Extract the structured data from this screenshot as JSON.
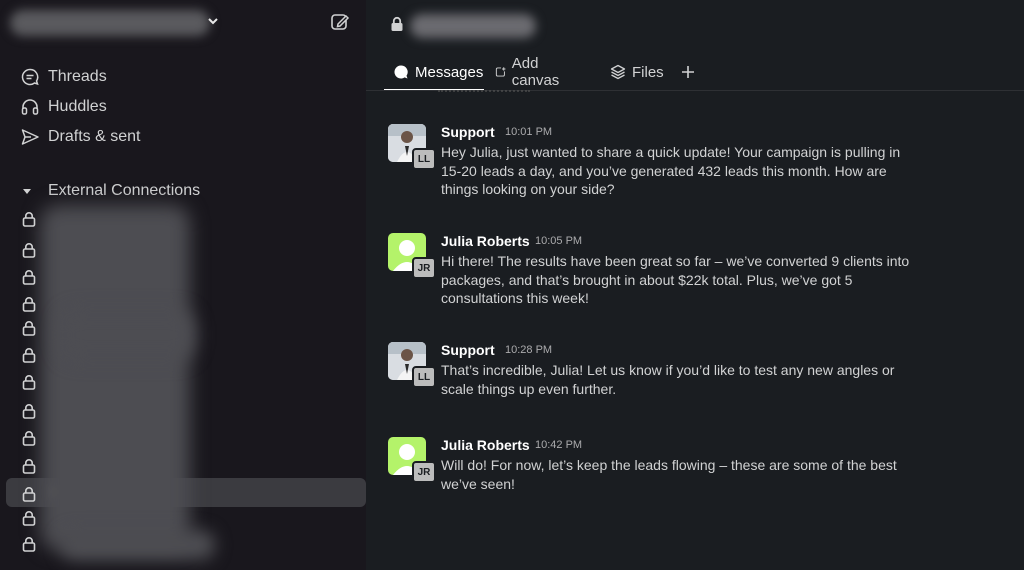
{
  "sidebar": {
    "nav": [
      {
        "label": "Threads",
        "icon": "threads-icon"
      },
      {
        "label": "Huddles",
        "icon": "headphones-icon"
      },
      {
        "label": "Drafts & sent",
        "icon": "send-icon"
      }
    ],
    "section_title": "External Connections"
  },
  "tabs": [
    {
      "label": "Messages",
      "icon": "message-bubble-icon"
    },
    {
      "label": "Add canvas",
      "icon": "add-canvas-icon"
    },
    {
      "label": "Files",
      "icon": "files-stack-icon"
    }
  ],
  "messages": [
    {
      "name": "Support",
      "time": "10:01 PM",
      "badge": "LL",
      "text": "Hey Julia, just wanted to share a quick update! Your campaign is pulling in 15-20 leads a day, and you’ve generated 432 leads this month. How are things looking on your side?"
    },
    {
      "name": "Julia Roberts",
      "time": "10:05 PM",
      "badge": "JR",
      "text": "Hi there! The results have been great so far – we’ve converted 9 clients into packages, and that’s brought in about $22k total. Plus, we’ve got 5 consultations this week!"
    },
    {
      "name": "Support",
      "time": "10:28 PM",
      "badge": "LL",
      "text": "That’s incredible, Julia! Let us know if you’d like to test any new angles or scale things up even further."
    },
    {
      "name": "Julia Roberts",
      "time": "10:42 PM",
      "badge": "JR",
      "text": "Will do! For now, let’s keep the leads flowing – these are some of the best we’ve seen!"
    }
  ],
  "colors": {
    "sidebar_bg": "#19171d",
    "main_bg": "#1a1d21",
    "selected_row": "#3b3b40",
    "jr_avatar": "#b4f36a"
  }
}
